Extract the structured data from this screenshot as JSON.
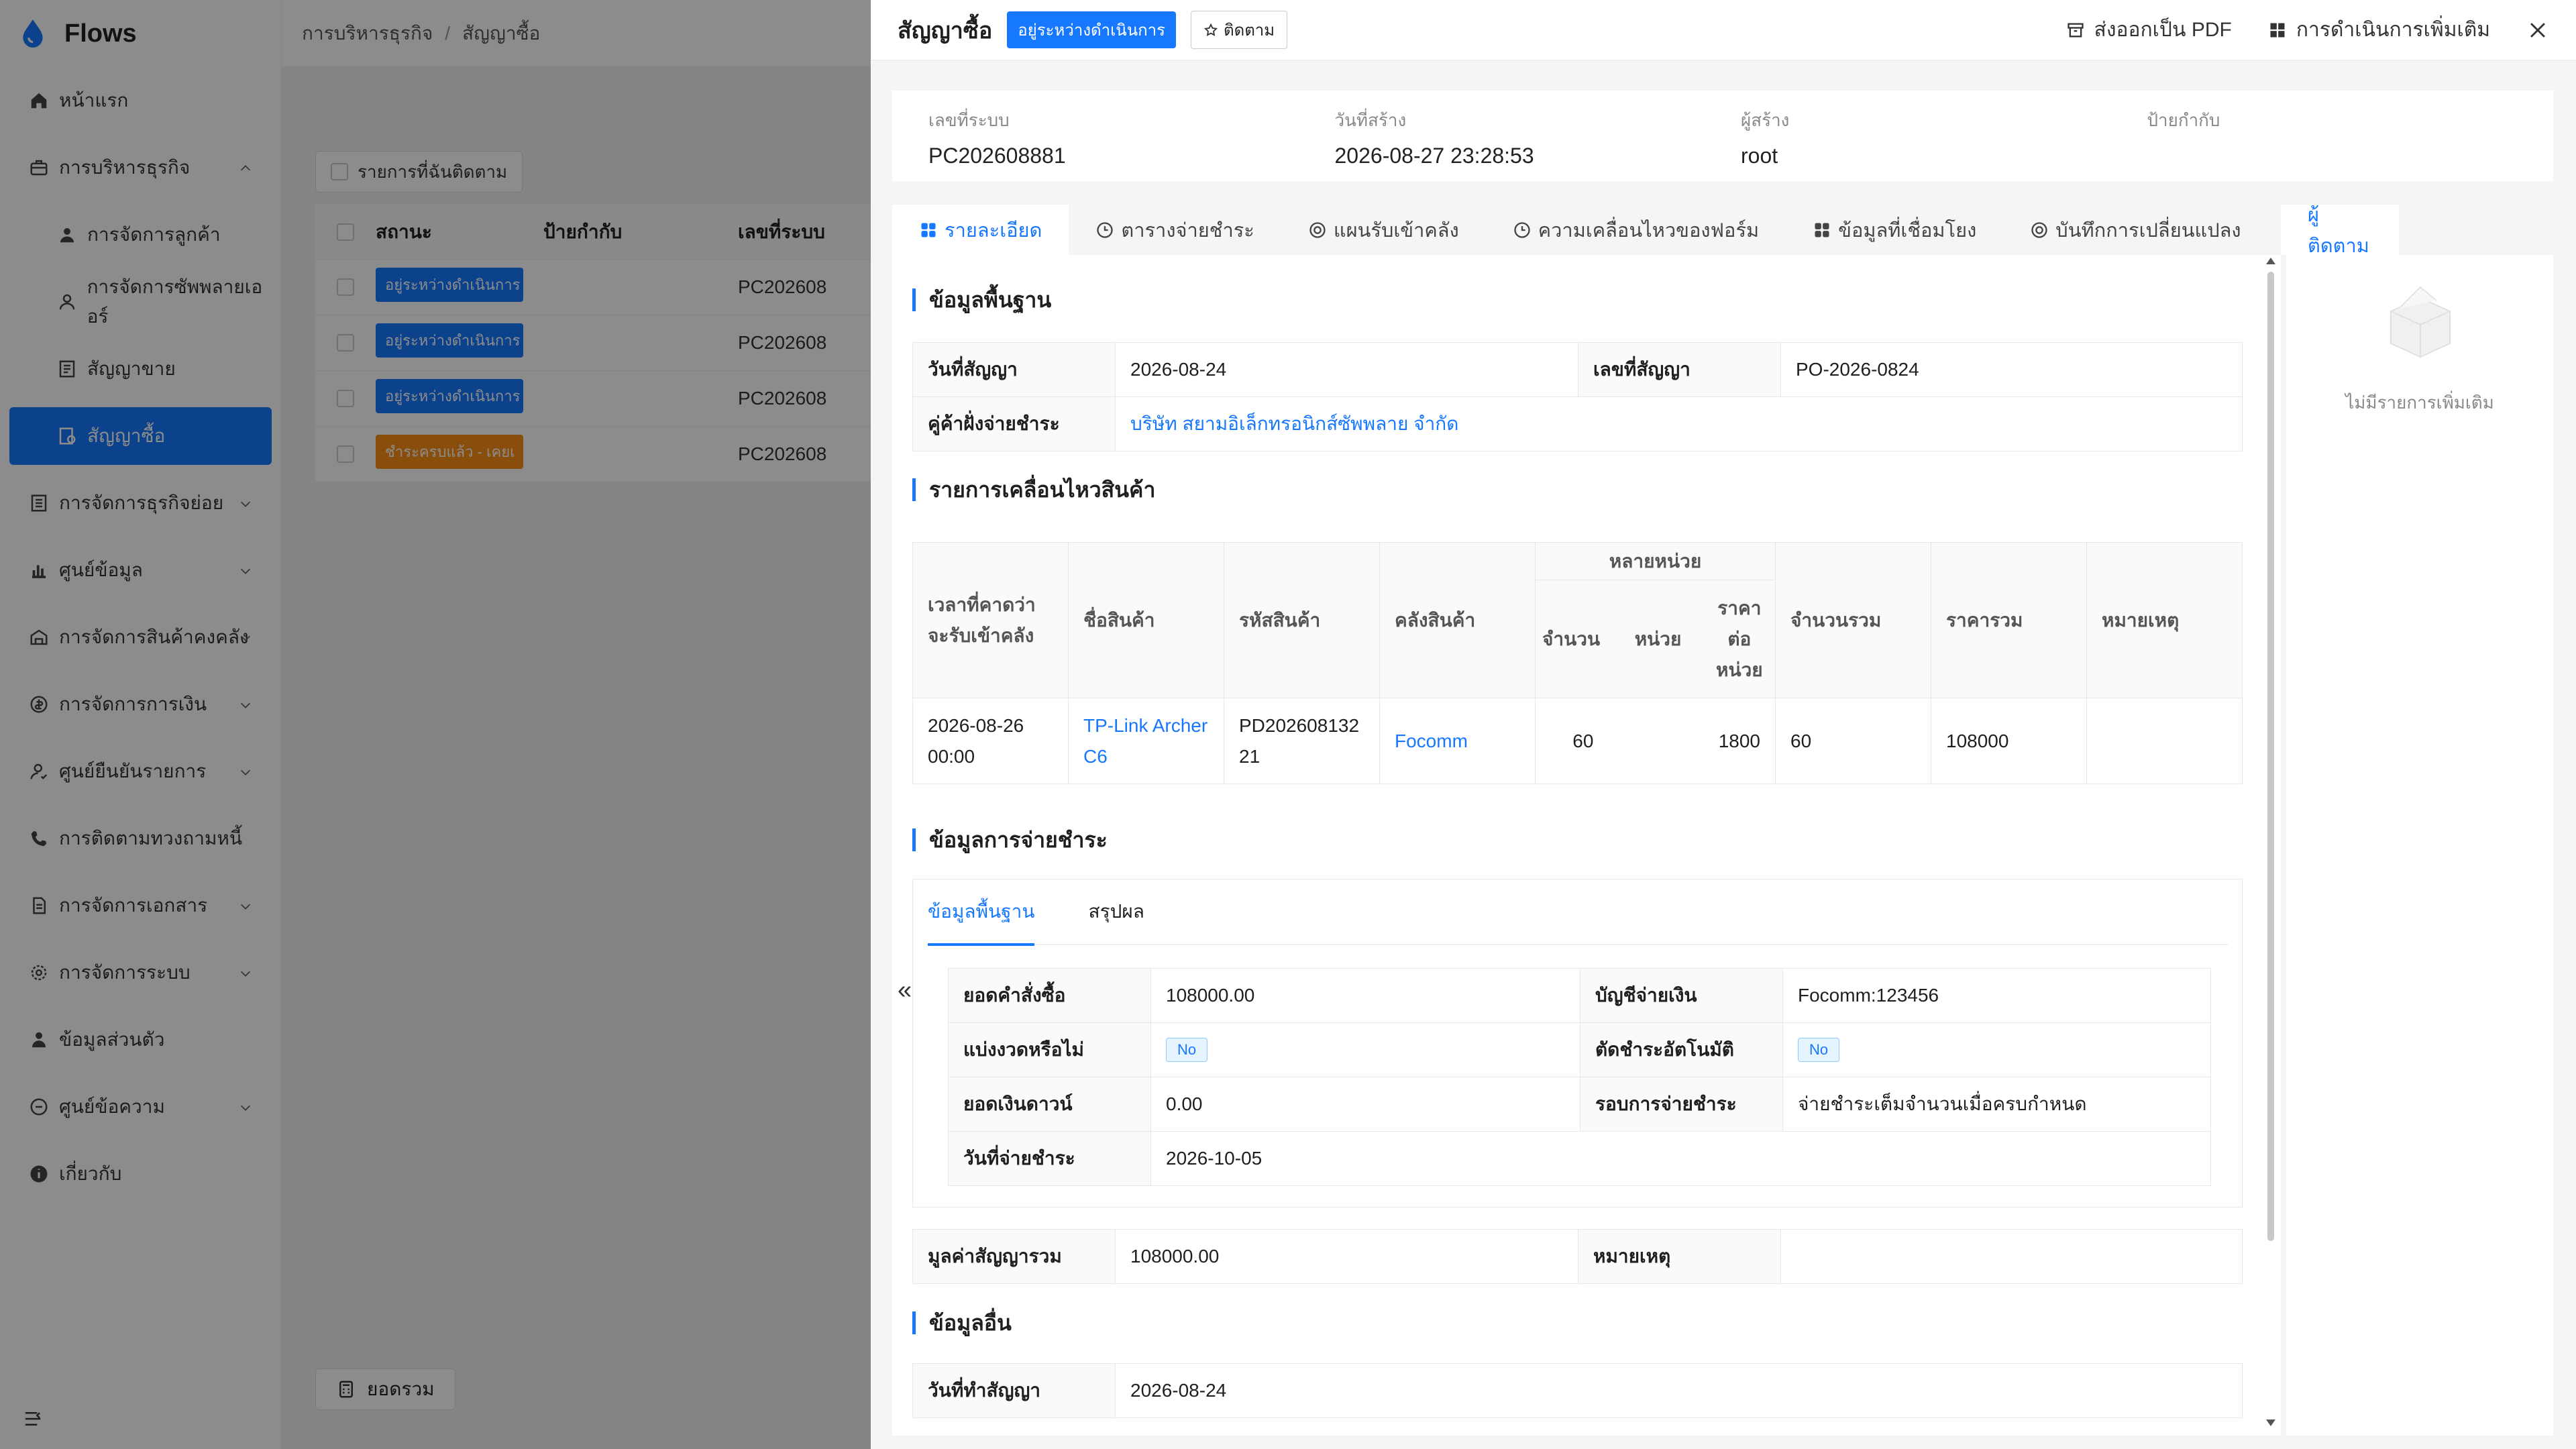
{
  "app": {
    "name": "Flows"
  },
  "sidebar": {
    "items": [
      {
        "label": "หน้าแรก",
        "icon": "home-icon"
      },
      {
        "label": "การบริหารธุรกิจ",
        "icon": "briefcase-icon",
        "expanded": true
      },
      {
        "label": "การจัดการลูกค้า",
        "icon": "user-icon",
        "sub": true
      },
      {
        "label": "การจัดการซัพพลายเออร์",
        "icon": "user-outline-icon",
        "sub": true
      },
      {
        "label": "สัญญาขาย",
        "icon": "contract-icon",
        "sub": true
      },
      {
        "label": "สัญญาซื้อ",
        "icon": "purchase-contract-icon",
        "sub": true,
        "active": true
      },
      {
        "label": "การจัดการธุรกิจย่อย",
        "icon": "list-icon"
      },
      {
        "label": "ศูนย์ข้อมูล",
        "icon": "bar-chart-icon"
      },
      {
        "label": "การจัดการสินค้าคงคลัง",
        "icon": "warehouse-icon"
      },
      {
        "label": "การจัดการการเงิน",
        "icon": "money-icon"
      },
      {
        "label": "ศูนย์ยืนยันรายการ",
        "icon": "user-check-icon"
      },
      {
        "label": "การติดตามทวงถามหนี้",
        "icon": "phone-icon"
      },
      {
        "label": "การจัดการเอกสาร",
        "icon": "document-icon"
      },
      {
        "label": "การจัดการระบบ",
        "icon": "gear-icon"
      },
      {
        "label": "ข้อมูลส่วนตัว",
        "icon": "person-icon"
      },
      {
        "label": "ศูนย์ข้อความ",
        "icon": "message-icon"
      },
      {
        "label": "เกี่ยวกับ",
        "icon": "info-icon"
      }
    ]
  },
  "background": {
    "breadcrumb": [
      "การบริหารธุรกิจ",
      "สัญญาซื้อ"
    ],
    "filter_label": "รายการที่ฉันติดตาม",
    "columns": [
      "สถานะ",
      "ป้ายกำกับ",
      "เลขที่ระบบ"
    ],
    "rows": [
      {
        "status": "อยู่ระหว่างดำเนินการ",
        "status_color": "#1677ff",
        "number": "PC202608"
      },
      {
        "status": "อยู่ระหว่างดำเนินการ",
        "status_color": "#1677ff",
        "number": "PC202608"
      },
      {
        "status": "อยู่ระหว่างดำเนินการ",
        "status_color": "#1677ff",
        "number": "PC202608"
      },
      {
        "status": "ชำระครบแล้ว - เคยเ",
        "status_color": "#fa8c16",
        "number": "PC202608"
      }
    ],
    "footer_label": "ยอดรวม"
  },
  "drawer": {
    "title": "สัญญาซื้อ",
    "status": "อยู่ระหว่างดำเนินการ",
    "follow_label": "ติดตาม",
    "export_label": "ส่งออกเป็น PDF",
    "more_label": "การดำเนินการเพิ่มเติม",
    "meta": [
      {
        "label": "เลขที่ระบบ",
        "value": "PC202608881"
      },
      {
        "label": "วันที่สร้าง",
        "value": "2026-08-27 23:28:53"
      },
      {
        "label": "ผู้สร้าง",
        "value": "root"
      },
      {
        "label": "ป้ายกำกับ",
        "value": ""
      }
    ],
    "tabs": [
      {
        "label": "รายละเอียด",
        "icon": "grid-icon",
        "active": true
      },
      {
        "label": "ตารางจ่ายชำระ",
        "icon": "clock-icon"
      },
      {
        "label": "แผนรับเข้าคลัง",
        "icon": "circle-icon"
      },
      {
        "label": "ความเคลื่อนไหวของฟอร์ม",
        "icon": "clock-icon"
      },
      {
        "label": "ข้อมูลที่เชื่อมโยง",
        "icon": "grid-icon"
      },
      {
        "label": "บันทึกการเปลี่ยนแปลง",
        "icon": "circle-icon"
      }
    ],
    "followers_tab": "ผู้ติดตาม",
    "followers_empty": "ไม่มีรายการเพิ่มเติม",
    "sections": {
      "basic": "ข้อมูลพื้นฐาน",
      "movement": "รายการเคลื่อนไหวสินค้า",
      "payment": "ข้อมูลการจ่ายชำระ",
      "other": "ข้อมูลอื่น"
    },
    "basic": {
      "contract_date_label": "วันที่สัญญา",
      "contract_date": "2026-08-24",
      "contract_no_label": "เลขที่สัญญา",
      "contract_no": "PO-2026-0824",
      "party_label": "คู่ค้าฝั่งจ่ายชำระ",
      "party": "บริษัท สยามอิเล็กทรอนิกส์ซัพพลาย จำกัด"
    },
    "movement": {
      "headers": {
        "time": "เวลาที่คาดว่าจะรับเข้าคลัง",
        "product": "ชื่อสินค้า",
        "code": "รหัสสินค้า",
        "warehouse": "คลังสินค้า",
        "multi_unit": "หลายหน่วย",
        "qty": "จำนวน",
        "unit": "หน่วย",
        "unit_price": "ราคาต่อหน่วย",
        "total_qty": "จำนวนรวม",
        "total_price": "ราคารวม",
        "remark": "หมายเหตุ"
      },
      "rows": [
        {
          "time": "2026-08-26 00:00",
          "product": "TP-Link Archer C6",
          "code": "PD20260813221",
          "warehouse": "Focomm",
          "qty": "60",
          "unit": "",
          "unit_price": "1800",
          "total_qty": "60",
          "total_price": "108000",
          "remark": ""
        }
      ]
    },
    "payment": {
      "tabs": [
        "ข้อมูลพื้นฐาน",
        "สรุปผล"
      ],
      "order_amount_label": "ยอดคำสั่งซื้อ",
      "order_amount": "108000.00",
      "account_label": "บัญชีจ่ายเงิน",
      "account": "Focomm:123456",
      "installment_label": "แบ่งงวดหรือไม่",
      "installment": "No",
      "auto_deduct_label": "ตัดชำระอัตโนมัติ",
      "auto_deduct": "No",
      "down_payment_label": "ยอดเงินดาวน์",
      "down_payment": "0.00",
      "cycle_label": "รอบการจ่ายชำระ",
      "cycle": "จ่ายชำระเต็มจำนวนเมื่อครบกำหนด",
      "pay_date_label": "วันที่จ่ายชำระ",
      "pay_date": "2026-10-05"
    },
    "summary": {
      "total_label": "มูลค่าสัญญารวม",
      "total": "108000.00",
      "remark_label": "หมายเหตุ",
      "remark": ""
    },
    "other": {
      "signing_date_label": "วันที่ทำสัญญา",
      "signing_date": "2026-08-24"
    }
  }
}
